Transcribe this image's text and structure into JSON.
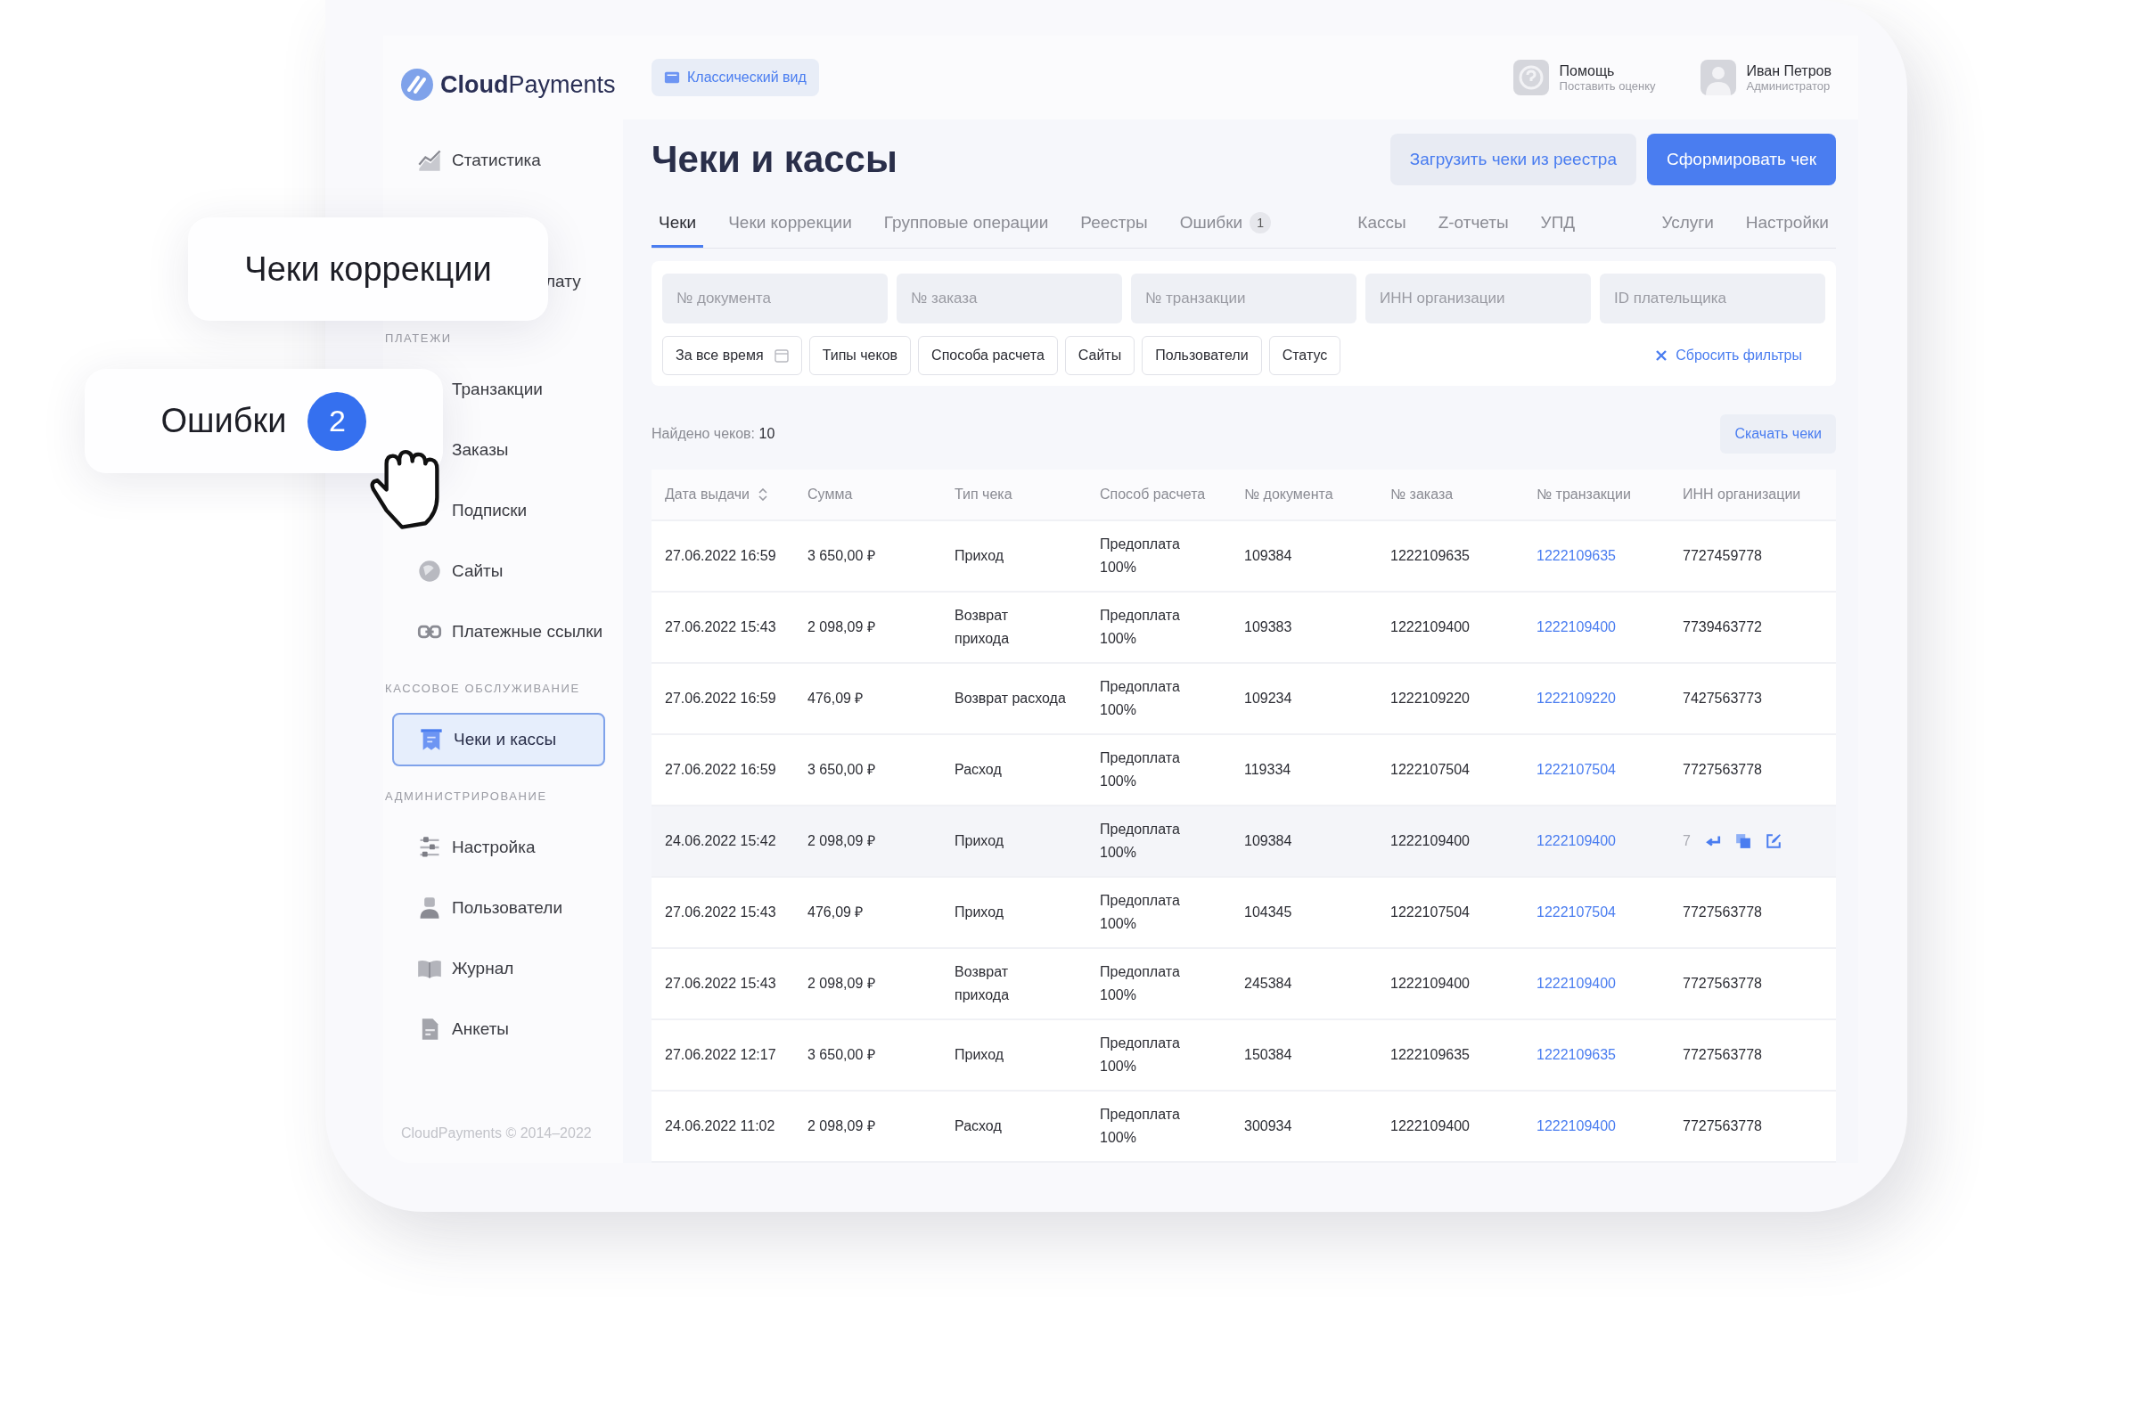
{
  "sidebar": {
    "logo": "**Cloud**Payments",
    "sections": [
      {
        "items": [
          {
            "kind": "item",
            "label": "Статистика",
            "selected": false
          },
          {
            "kind": "covered",
            "selected": false
          },
          {
            "kind": "tail",
            "label": "лату",
            "selected": false
          }
        ]
      },
      {
        "heading": "ПЛАТЕЖИ",
        "items": [
          {
            "kind": "bare",
            "label": "Транзакции",
            "selected": false
          },
          {
            "kind": "bare",
            "label": "Заказы",
            "selected": false
          },
          {
            "kind": "bare",
            "label": "Подписки",
            "selected": false
          },
          {
            "kind": "item",
            "label": "Сайты",
            "selected": false
          },
          {
            "kind": "item",
            "label": "Платежные ссылки",
            "selected": false
          }
        ]
      },
      {
        "heading": "КАССОВОЕ ОБСЛУЖИВАНИЕ",
        "items": [
          {
            "kind": "item",
            "label": "Чеки и кассы",
            "selected": true
          }
        ]
      },
      {
        "heading": "АДМИНИСТРИРОВАНИЕ",
        "items": [
          {
            "kind": "item",
            "label": "Настройка",
            "selected": false
          },
          {
            "kind": "item",
            "label": "Пользователи",
            "selected": false
          },
          {
            "kind": "item",
            "label": "Журнал",
            "selected": false
          },
          {
            "kind": "item",
            "label": "Анкеты",
            "selected": false
          }
        ]
      }
    ],
    "footer": "CloudPayments © 2014–2022"
  },
  "top_bar": {
    "classic_view": "Классический вид",
    "help": {
      "title": "Помощь",
      "subtitle": "Поставить оценку"
    },
    "user": {
      "name": "Иван Петров",
      "role": "Администратор"
    }
  },
  "page_title": "Чеки и кассы",
  "actions": [
    {
      "label": "Загрузить чеки из реестра",
      "kind": "secondary"
    },
    {
      "label": "Сформировать чек",
      "kind": "primary"
    }
  ],
  "tab_groups": [
    [
      {
        "label": "Чеки",
        "selected": true
      },
      {
        "label": "Чеки коррекции",
        "selected": false
      },
      {
        "label": "Групповые операции",
        "selected": false
      },
      {
        "label": "Реестры",
        "selected": false
      },
      {
        "label": "Ошибки",
        "badge": "1",
        "selected": false
      }
    ],
    [
      {
        "label": "Кассы",
        "selected": false
      },
      {
        "label": "Z-отчеты",
        "selected": false
      },
      {
        "label": "УПД",
        "selected": false
      }
    ],
    [
      {
        "label": "Услуги",
        "selected": false
      },
      {
        "label": "Настройки",
        "selected": false
      }
    ]
  ],
  "filters": {
    "fields": [
      {
        "placeholder": "№ документа"
      },
      {
        "placeholder": "№ заказа"
      },
      {
        "placeholder": "№ транзакции"
      },
      {
        "placeholder": "ИНН организации"
      },
      {
        "placeholder": "ID плательщика"
      }
    ],
    "chips": [
      {
        "label": "За все время",
        "kind": "date"
      },
      {
        "label": "Типы чеков",
        "kind": "plain"
      },
      {
        "label": "Способа расчета",
        "kind": "plain"
      },
      {
        "label": "Сайты",
        "kind": "plain"
      },
      {
        "label": "Пользователи",
        "kind": "plain"
      },
      {
        "label": "Статус",
        "kind": "plain"
      }
    ],
    "reset": "Сбросить фильтры"
  },
  "summary": {
    "label": "Найдено чеков:",
    "count": "10"
  },
  "download": "Скачать чеки",
  "table": {
    "columns": [
      {
        "label": "Дата выдачи",
        "sortable": true,
        "kind": "text"
      },
      {
        "label": "Сумма",
        "sortable": false,
        "kind": "text"
      },
      {
        "label": "Тип чека",
        "sortable": false,
        "kind": "text"
      },
      {
        "label": "Способ расчета",
        "sortable": false,
        "kind": "text"
      },
      {
        "label": "№ документа",
        "sortable": false,
        "kind": "text"
      },
      {
        "label": "№ заказа",
        "sortable": false,
        "kind": "text"
      },
      {
        "label": "№ транзакции",
        "sortable": false,
        "kind": "link"
      },
      {
        "label": "ИНН организации",
        "sortable": false,
        "kind": "text"
      }
    ],
    "rows": [
      {
        "hovered": false,
        "cells": [
          "27.06.2022 16:59",
          "3 650,00 ₽",
          "Приход",
          "Предоплата\n100%",
          "109384",
          "1222109635",
          "1222109635",
          "7727459778"
        ]
      },
      {
        "hovered": false,
        "cells": [
          "27.06.2022 15:43",
          "2 098,09 ₽",
          "Возврат\nприхода",
          "Предоплата\n100%",
          "109383",
          "1222109400",
          "1222109400",
          "7739463772"
        ]
      },
      {
        "hovered": false,
        "cells": [
          "27.06.2022 16:59",
          "476,09 ₽",
          "Возврат расхода",
          "Предоплата\n100%",
          "109234",
          "1222109220",
          "1222109220",
          "7427563773"
        ]
      },
      {
        "hovered": false,
        "cells": [
          "27.06.2022 16:59",
          "3 650,00 ₽",
          "Расход",
          "Предоплата\n100%",
          "119334",
          "1222107504",
          "1222107504",
          "7727563778"
        ]
      },
      {
        "hovered": true,
        "cells": [
          "24.06.2022 15:42",
          "2 098,09 ₽",
          "Приход",
          "Предоплата\n100%",
          "109384",
          "1222109400",
          "1222109400",
          "7"
        ]
      },
      {
        "hovered": false,
        "cells": [
          "27.06.2022 15:43",
          "476,09 ₽",
          "Приход",
          "Предоплата\n100%",
          "104345",
          "1222107504",
          "1222107504",
          "7727563778"
        ]
      },
      {
        "hovered": false,
        "cells": [
          "27.06.2022 15:43",
          "2 098,09 ₽",
          "Возврат\nприхода",
          "Предоплата\n100%",
          "245384",
          "1222109400",
          "1222109400",
          "7727563778"
        ]
      },
      {
        "hovered": false,
        "cells": [
          "27.06.2022 12:17",
          "3 650,00 ₽",
          "Приход",
          "Предоплата\n100%",
          "150384",
          "1222109635",
          "1222109635",
          "7727563778"
        ]
      },
      {
        "hovered": false,
        "cells": [
          "24.06.2022 11:02",
          "2 098,09 ₽",
          "Расход",
          "Предоплата\n100%",
          "300934",
          "1222109400",
          "1222109400",
          "7727563778"
        ]
      }
    ]
  },
  "overlay_cards": [
    {
      "label": "Чеки коррекции"
    },
    {
      "label": "Ошибки",
      "badge": "2"
    }
  ]
}
